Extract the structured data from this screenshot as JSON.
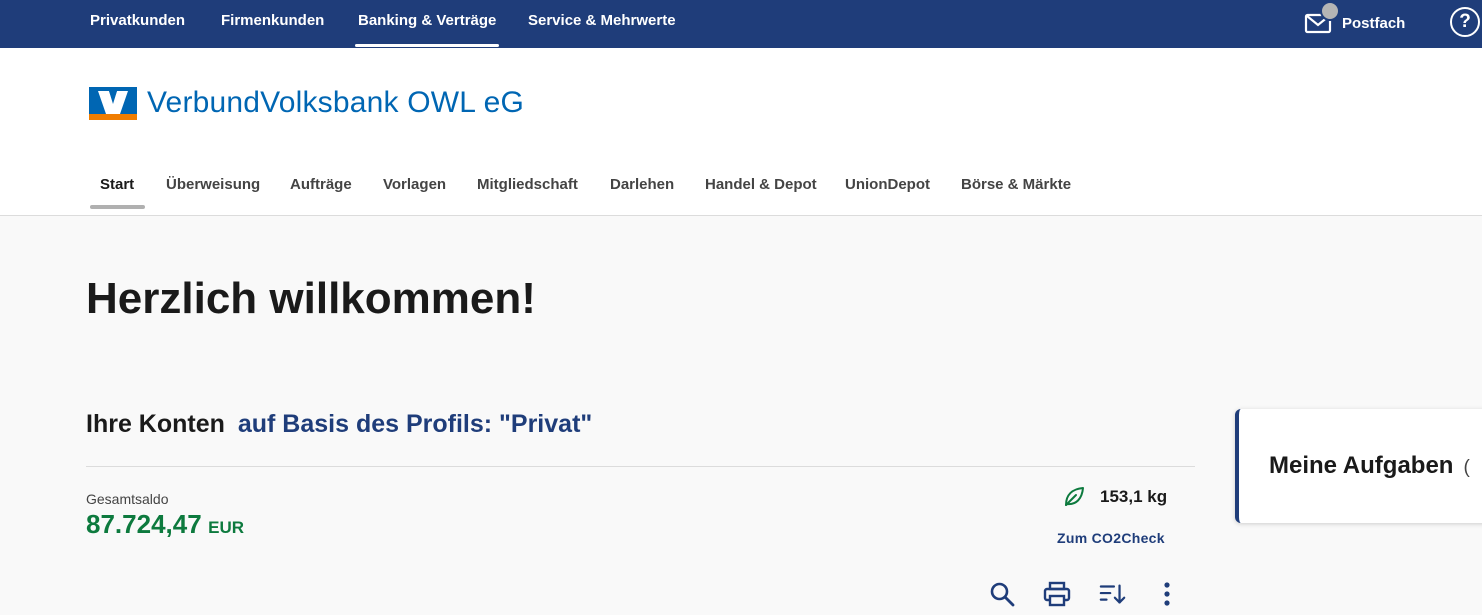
{
  "top_nav": {
    "items": [
      {
        "label": "Privatkunden"
      },
      {
        "label": "Firmenkunden"
      },
      {
        "label": "Banking & Verträge"
      },
      {
        "label": "Service & Mehrwerte"
      }
    ],
    "active": "Banking & Verträge",
    "postfach_label": "Postfach",
    "help_label": "?"
  },
  "brand": {
    "name": "VerbundVolksbank OWL eG",
    "colors": {
      "blue": "#0066b3",
      "orange": "#f07d00",
      "nav": "#1f3d7a"
    }
  },
  "sub_nav": {
    "items": [
      {
        "label": "Start"
      },
      {
        "label": "Überweisung"
      },
      {
        "label": "Aufträge"
      },
      {
        "label": "Vorlagen"
      },
      {
        "label": "Mitgliedschaft"
      },
      {
        "label": "Darlehen"
      },
      {
        "label": "Handel & Depot"
      },
      {
        "label": "UnionDepot"
      },
      {
        "label": "Börse & Märkte"
      }
    ],
    "active": "Start"
  },
  "main": {
    "welcome": "Herzlich willkommen!",
    "accounts_title": "Ihre Konten",
    "accounts_profile": "auf Basis des Profils: \"Privat\"",
    "total_label": "Gesamtsaldo",
    "total_value": "87.724,47",
    "total_currency": "EUR",
    "co2_value": "153,1 kg",
    "co2_link": "Zum CO2Check",
    "toolbar_icons": [
      "search-icon",
      "print-icon",
      "sort-icon",
      "more-vertical-icon"
    ]
  },
  "tasks_card": {
    "title": "Meine Aufgaben",
    "count_partial": "("
  }
}
